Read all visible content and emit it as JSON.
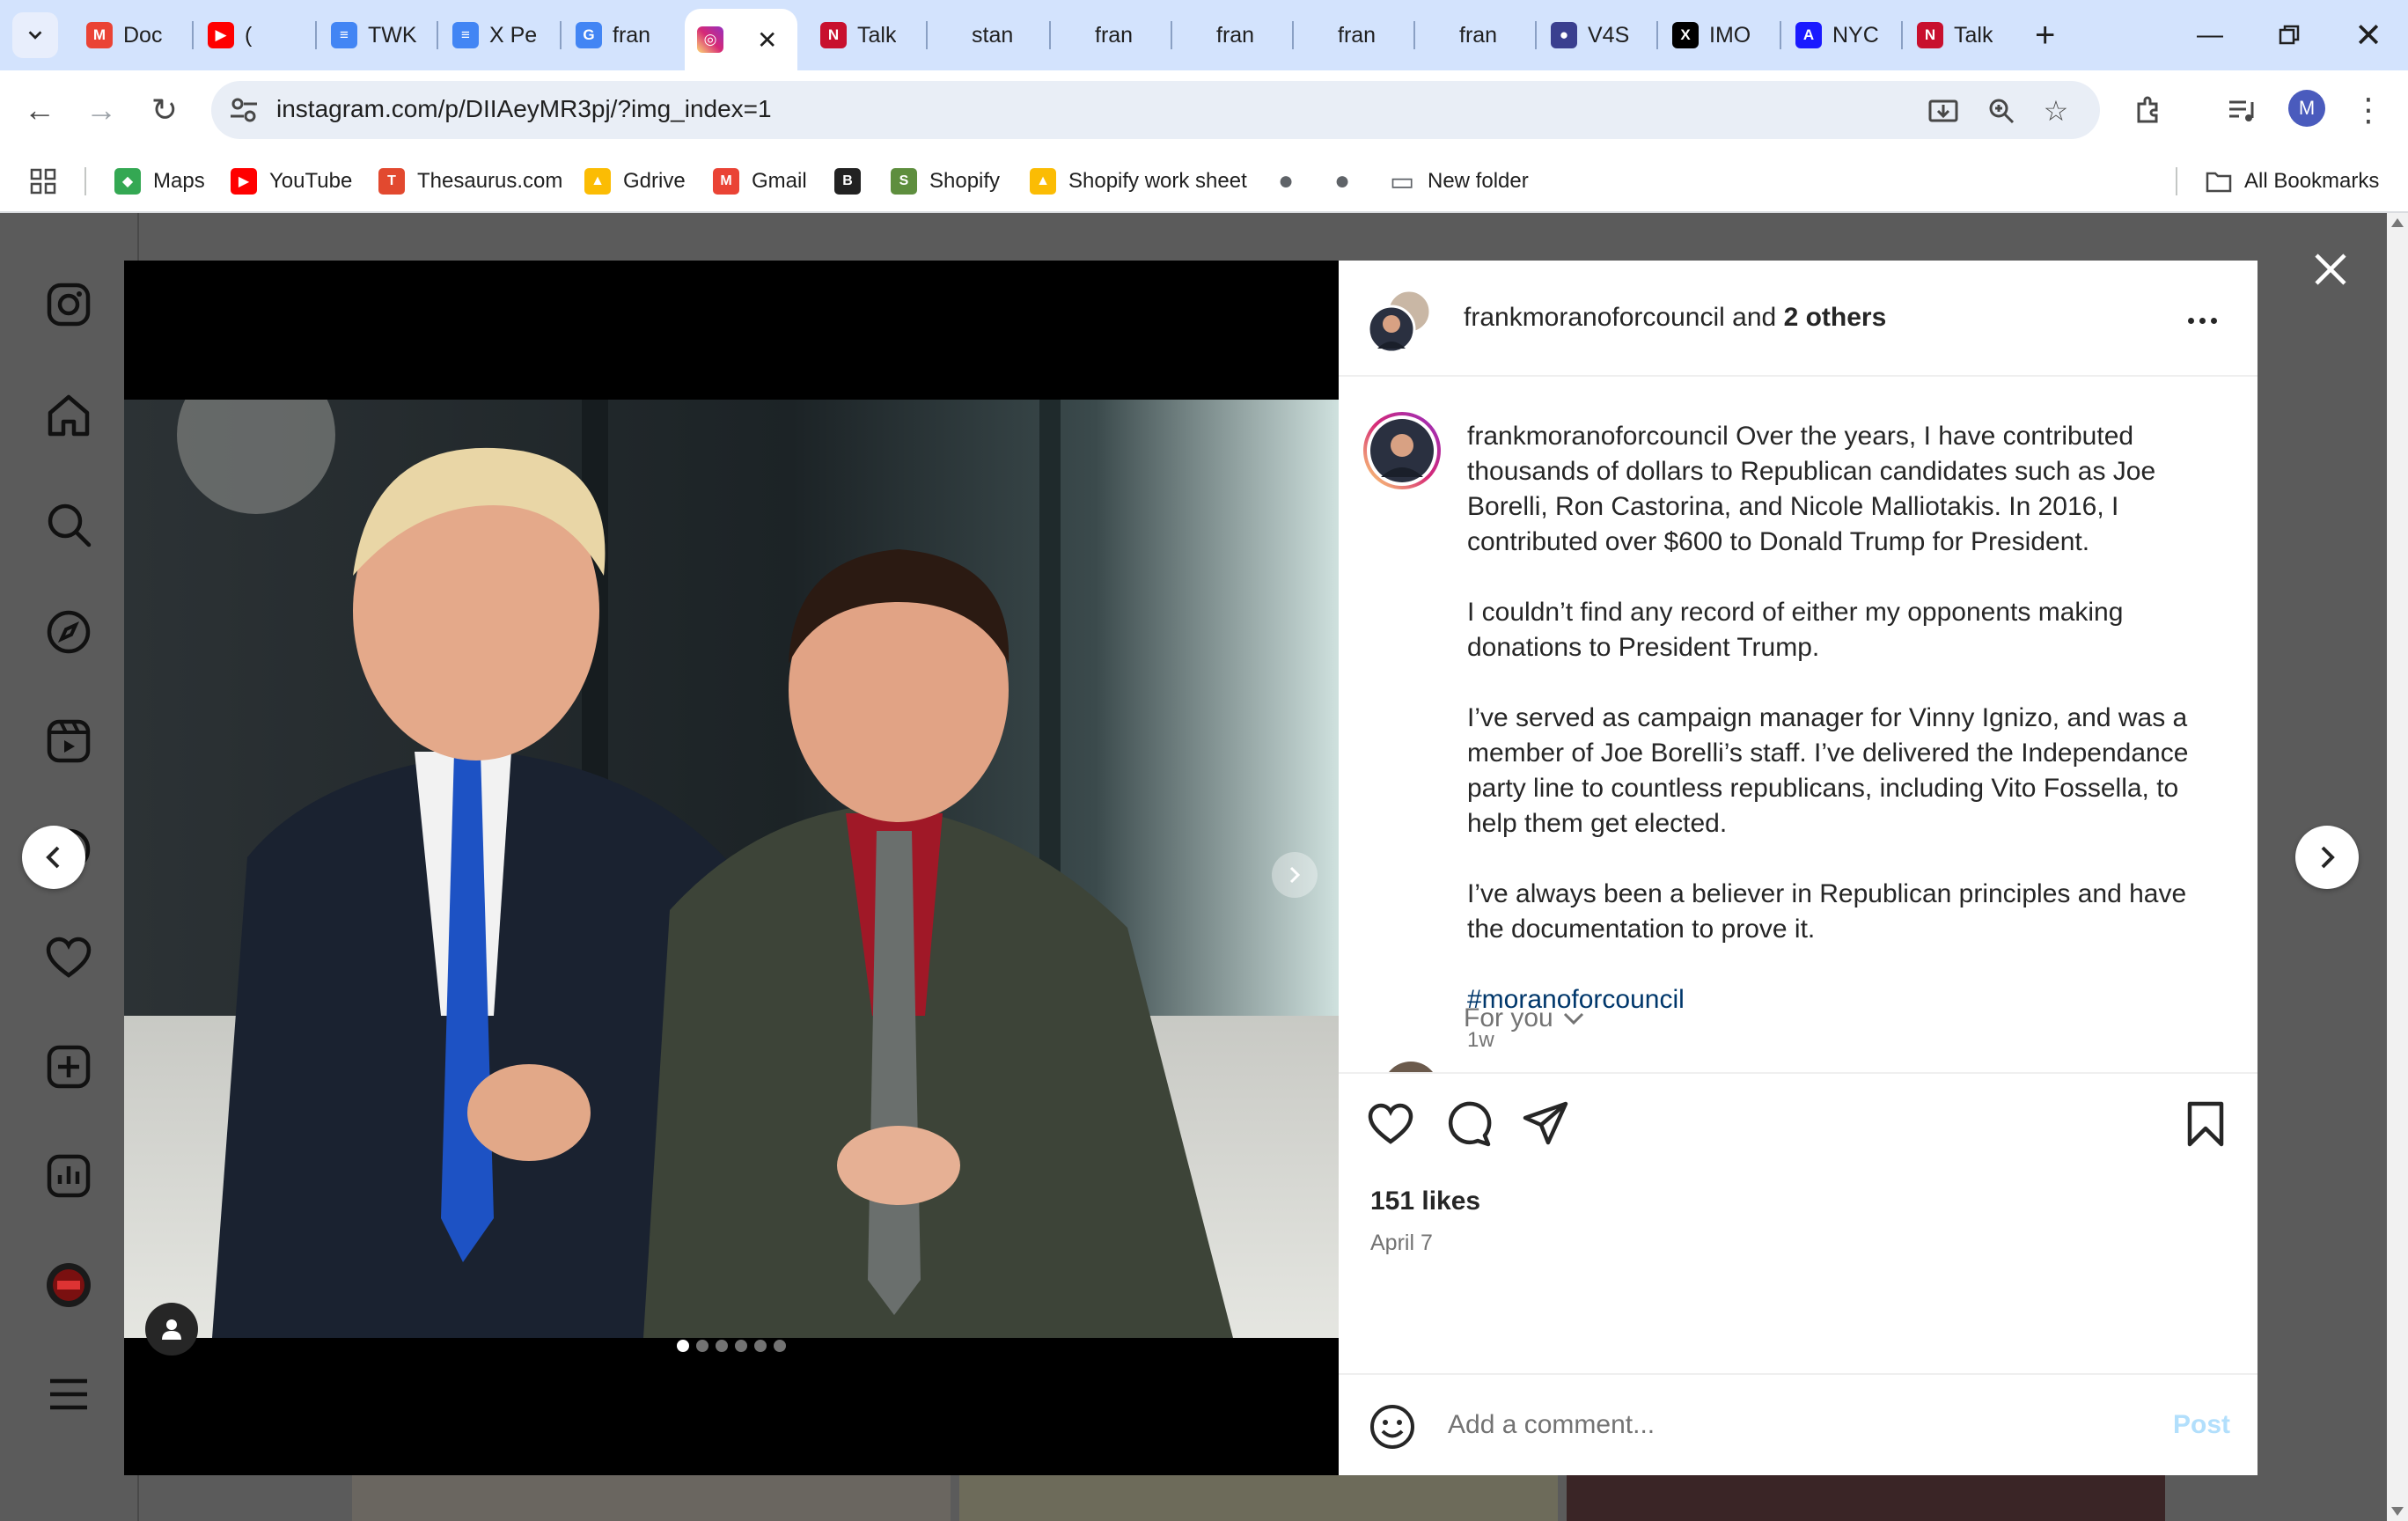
{
  "browser": {
    "tabs": [
      {
        "title": "Doc",
        "icon": "gmail-icon",
        "color": "#ea4335"
      },
      {
        "title": "(",
        "icon": "youtube-icon",
        "color": "#ff0000"
      },
      {
        "title": "TWK",
        "icon": "docs-icon",
        "color": "#4285f4"
      },
      {
        "title": "X Pe",
        "icon": "docs-icon",
        "color": "#4285f4"
      },
      {
        "title": "fran",
        "icon": "google-icon",
        "color": "#4285f4"
      },
      {
        "title": "",
        "icon": "instagram-icon",
        "color": "#e1306c"
      },
      {
        "title": "Talk",
        "icon": "nypost-icon",
        "color": "#c8102e"
      },
      {
        "title": "stan",
        "icon": "blank-icon",
        "color": "#d3e3fd"
      },
      {
        "title": "fran",
        "icon": "blank-icon",
        "color": "#d3e3fd"
      },
      {
        "title": "fran",
        "icon": "blank-icon",
        "color": "#d3e3fd"
      },
      {
        "title": "fran",
        "icon": "blank-icon",
        "color": "#d3e3fd"
      },
      {
        "title": "fran",
        "icon": "blank-icon",
        "color": "#d3e3fd"
      },
      {
        "title": "V4S",
        "icon": "globe-icon",
        "color": "#3a3f8f"
      },
      {
        "title": "IMO",
        "icon": "x-icon",
        "color": "#000000"
      },
      {
        "title": "NYC",
        "icon": "aol-icon",
        "color": "#1a1aff"
      },
      {
        "title": "Talk",
        "icon": "nypost-icon",
        "color": "#c8102e"
      }
    ],
    "url": "instagram.com/p/DIIAeyMR3pj/?img_index=1",
    "profile_initial": "M",
    "bookmarks": [
      {
        "label": "Maps",
        "icon": "maps-icon",
        "color": "#34a853"
      },
      {
        "label": "YouTube",
        "icon": "youtube-icon",
        "color": "#ff0000"
      },
      {
        "label": "Thesaurus.com",
        "icon": "thesaurus-icon",
        "color": "#e2492f"
      },
      {
        "label": "Gdrive",
        "icon": "drive-icon",
        "color": "#fbbc04"
      },
      {
        "label": "Gmail",
        "icon": "gmail-icon",
        "color": "#ea4335"
      },
      {
        "label": "",
        "icon": "bbc-icon",
        "color": "#222222"
      },
      {
        "label": "Shopify",
        "icon": "shopify-icon",
        "color": "#5e8e3e"
      },
      {
        "label": "Shopify work sheet",
        "icon": "drive-icon",
        "color": "#fbbc04"
      },
      {
        "label": "",
        "icon": "globe-icon",
        "color": "#5f6368"
      },
      {
        "label": "",
        "icon": "globe-icon",
        "color": "#5f6368"
      },
      {
        "label": "New folder",
        "icon": "folder-icon",
        "color": "#5f6368"
      }
    ],
    "all_bookmarks": "All Bookmarks"
  },
  "post": {
    "header": {
      "username": "frankmoranoforcouncil",
      "and": "and",
      "others": "2 others"
    },
    "caption": {
      "username": "frankmoranoforcouncil",
      "p1": "Over the years, I have contributed thousands of dollars to Republican candidates such as Joe Borelli, Ron Castorina, and Nicole Malliotakis. In 2016, I contributed over $600 to Donald Trump for President.",
      "p2": "I couldn’t find any record of either my opponents making donations to President Trump.",
      "p3": "I’ve served as campaign manager for Vinny Ignizo, and was a member of Joe Borelli’s staff. I’ve delivered the Independance party line to countless republicans, including Vito Fossella, to help them get elected.",
      "p4": "I’ve always been a believer in Republican principles and have the documentation to prove it.",
      "hashtag": "#moranoforcouncil",
      "time": "1w"
    },
    "for_you": "For you",
    "likes": "151 likes",
    "date": "April 7",
    "comment_placeholder": "Add a comment...",
    "post_button": "Post",
    "carousel": {
      "count": 6,
      "active": 0
    },
    "colors": {
      "link": "#00376b",
      "post_disabled": "#b2dffc",
      "muted": "#737373"
    }
  }
}
